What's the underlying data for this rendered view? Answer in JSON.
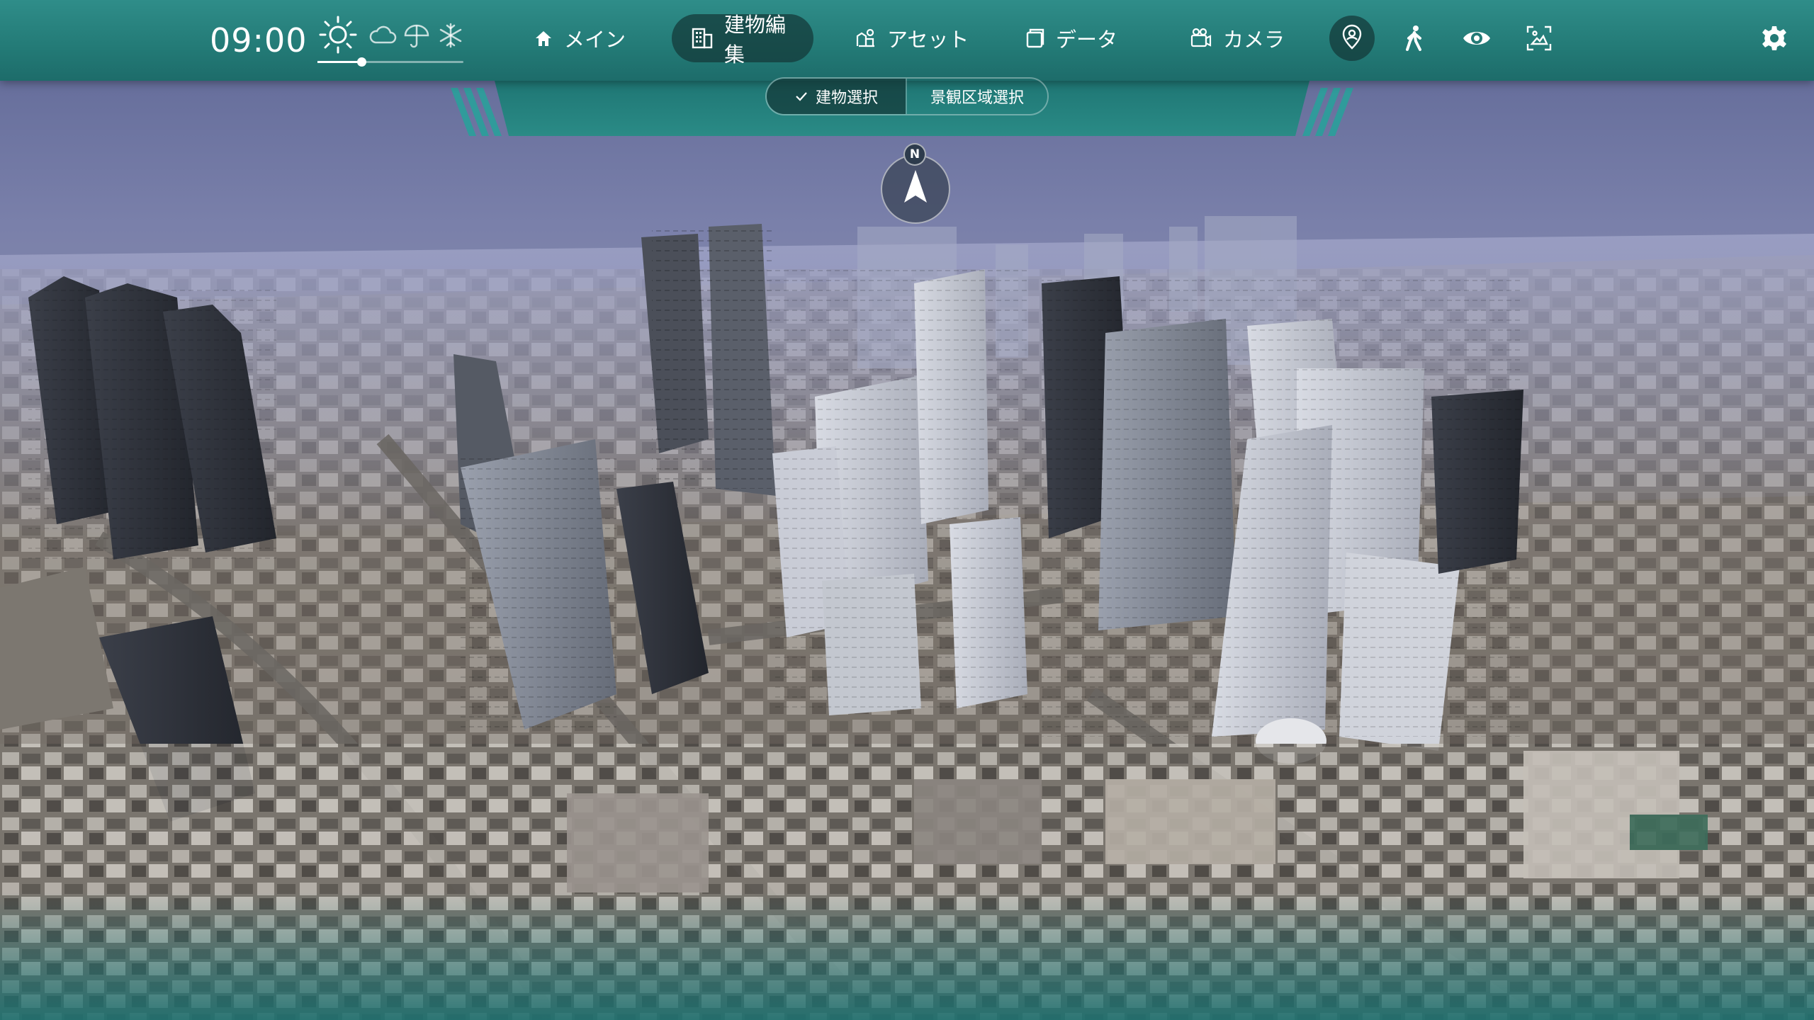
{
  "header": {
    "time": "09:00",
    "time_progress": 0.3,
    "weather": [
      {
        "name": "sun-icon",
        "selected": true
      },
      {
        "name": "cloud-icon",
        "selected": false
      },
      {
        "name": "umbrella-icon",
        "selected": false
      },
      {
        "name": "snow-icon",
        "selected": false
      }
    ]
  },
  "nav": {
    "items": [
      {
        "label": "メイン",
        "icon": "home-icon",
        "active": false
      },
      {
        "label": "建物編集",
        "icon": "building-icon",
        "active": true
      },
      {
        "label": "アセット",
        "icon": "asset-icon",
        "active": false
      },
      {
        "label": "データ",
        "icon": "data-icon",
        "active": false
      },
      {
        "label": "カメラ",
        "icon": "camera-icon",
        "active": false
      }
    ]
  },
  "tools": [
    {
      "name": "pedestrian-view-icon",
      "active": true
    },
    {
      "name": "walk-icon",
      "active": false
    },
    {
      "name": "eye-icon",
      "active": false
    },
    {
      "name": "screenshot-icon",
      "active": false
    },
    {
      "name": "gear-icon",
      "active": false
    }
  ],
  "subtabs": {
    "items": [
      {
        "label": "建物選択",
        "active": true
      },
      {
        "label": "景観区域選択",
        "active": false
      }
    ]
  },
  "compass": {
    "north_label": "N"
  },
  "colors": {
    "bar_top": "#2f8d89",
    "bar_bottom": "#1d6c6a",
    "active_pill": "#143737"
  }
}
